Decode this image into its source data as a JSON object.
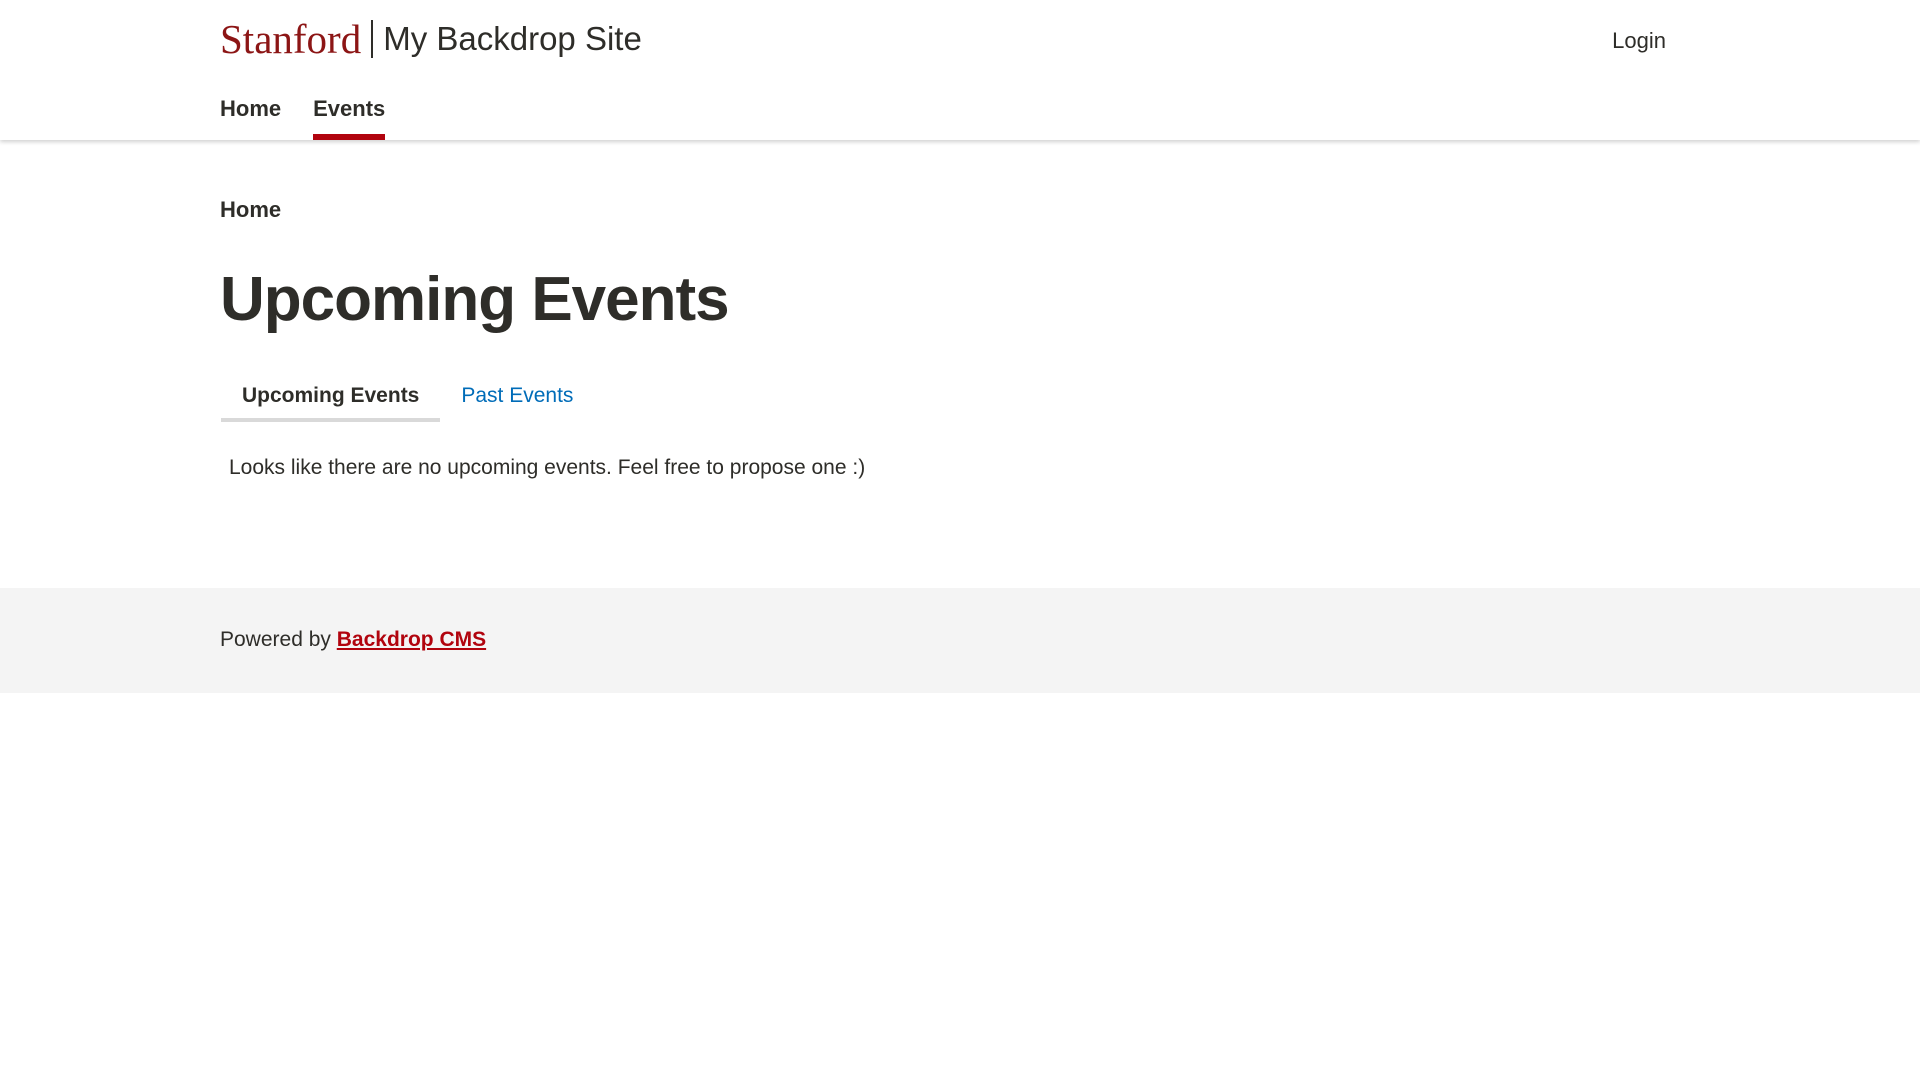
{
  "header": {
    "logo_text": "Stanford",
    "site_name": "My Backdrop Site",
    "login_label": "Login",
    "nav": [
      {
        "label": "Home"
      },
      {
        "label": "Events"
      }
    ]
  },
  "breadcrumb": {
    "home_label": "Home"
  },
  "page": {
    "title": "Upcoming Events",
    "tabs": [
      {
        "label": "Upcoming Events"
      },
      {
        "label": "Past Events"
      }
    ],
    "empty_message": "Looks like there are no upcoming events. Feel free to propose one :)"
  },
  "footer": {
    "powered_by": "Powered by",
    "link_label": "Backdrop CMS"
  },
  "colors": {
    "brand_red": "#8c1515",
    "accent_red": "#b1040e",
    "link_blue": "#006cb8",
    "text_dark": "#2e2d29",
    "footer_bg": "#f4f4f4"
  }
}
